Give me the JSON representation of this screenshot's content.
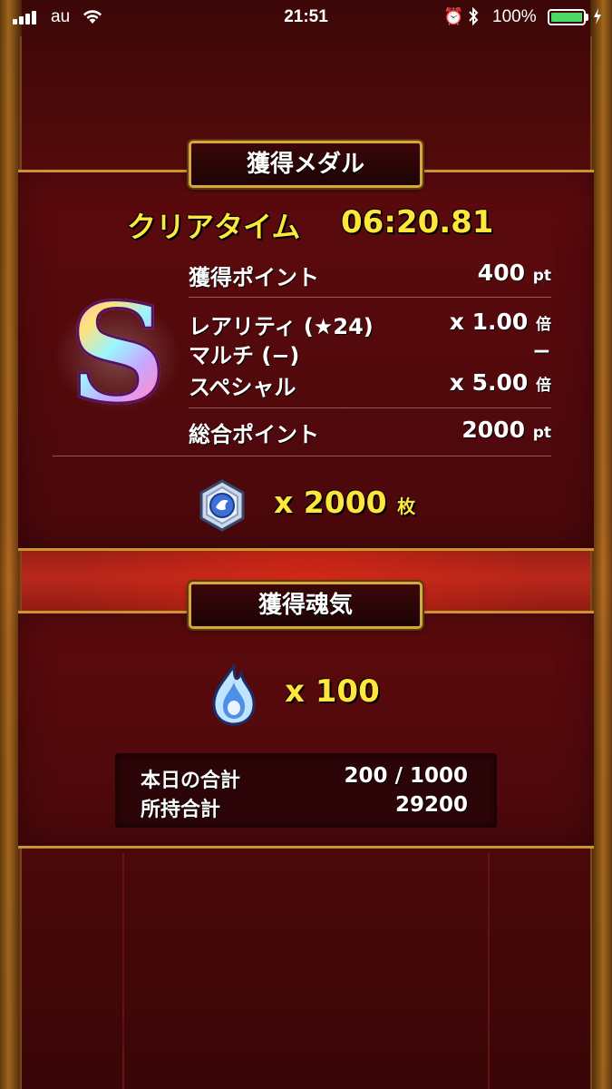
{
  "status_bar": {
    "carrier": "au",
    "time": "21:51",
    "battery_percent": "100%",
    "battery_level": 1.0,
    "icons": [
      "signal-icon",
      "wifi-icon",
      "alarm-icon",
      "bluetooth-icon",
      "battery-icon",
      "charging-icon"
    ]
  },
  "medal_section": {
    "title": "獲得メダル",
    "clear_time_label": "クリアタイム",
    "clear_time_value": "06:20.81",
    "rank": "S",
    "rows": {
      "points_label": "獲得ポイント",
      "points_value": "400",
      "points_unit": "pt",
      "rarity_label": "レアリティ (★24)",
      "rarity_value": "x 1.00",
      "rarity_unit": "倍",
      "multi_label": "マルチ (−)",
      "multi_value": "−",
      "special_label": "スペシャル",
      "special_value": "x 5.00",
      "special_unit": "倍",
      "total_label": "総合ポイント",
      "total_value": "2000",
      "total_unit": "pt"
    },
    "medal_count": "x 2000",
    "medal_unit": "枚"
  },
  "soul_section": {
    "title": "獲得魂気",
    "soul_count": "x 100",
    "today_label": "本日の合計",
    "today_value": "200 / 1000",
    "owned_label": "所持合計",
    "owned_value": "29200"
  },
  "colors": {
    "gold_text": "#ffe63a",
    "gold_border": "#c9962e",
    "panel_bg": "#5c0a0d",
    "battery_green": "#4cd964"
  }
}
